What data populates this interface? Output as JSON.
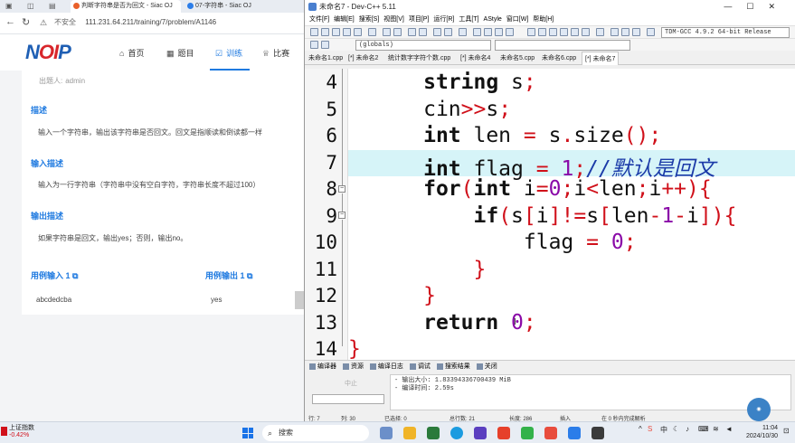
{
  "browser": {
    "tabs": [
      {
        "label": "判断字符串是否为回文 - Siac OJ"
      },
      {
        "label": "07-字符串 - Siac OJ"
      }
    ],
    "address": {
      "security": "不安全",
      "url": "111.231.64.211/training/7/problem/A1146"
    },
    "site": {
      "logo_main": "N",
      "logo_accent": "OI",
      "logo_end": "P",
      "nav": [
        {
          "label": "首页",
          "icon": "home-icon"
        },
        {
          "label": "题目",
          "icon": "grid-icon"
        },
        {
          "label": "训练",
          "icon": "check-icon"
        },
        {
          "label": "比赛",
          "icon": "trophy-icon"
        }
      ]
    },
    "problem": {
      "author_label": "出题人:",
      "author": "admin",
      "desc_title": "描述",
      "desc": "输入一个字符串，输出该字符串是否回文。回文是指顺读和倒读都一样",
      "input_title": "输入描述",
      "input_desc": "输入为一行字符串（字符串中没有空白字符，字符串长度不超过100）",
      "output_title": "输出描述",
      "output_desc": "如果字符串是回文，输出yes；否则，输出no。",
      "sample_input_title": "用例输入 1",
      "sample_output_title": "用例输出 1",
      "sample_input": "abcdedcba",
      "sample_output": "yes"
    }
  },
  "devcpp": {
    "title": "未命名7 - Dev-C++ 5.11",
    "menus": [
      "文件[F]",
      "编辑[E]",
      "搜索[S]",
      "视图[V]",
      "项目[P]",
      "运行[R]",
      "工具[T]",
      "AStyle",
      "窗口[W]",
      "帮助[H]"
    ],
    "globals_combo": "(globals)",
    "compiler_combo": "TDM-GCC 4.9.2 64-bit Release",
    "file_tabs": [
      "未命名1.cpp",
      "[*] 未命名2",
      "统计数字字符个数.cpp",
      "[*] 未命名4",
      "未命名5.cpp",
      "未命名6.cpp",
      "[*] 未命名7"
    ],
    "line_numbers": [
      "4",
      "5",
      "6",
      "7",
      "8",
      "9",
      "10",
      "11",
      "12",
      "13",
      "14"
    ],
    "code": {
      "l4_kw": "string",
      "l4_rest": " s",
      "l4_semi": ";",
      "l5_a": "cin",
      "l5_op": ">>",
      "l5_b": "s",
      "l5_semi": ";",
      "l6_kw": "int",
      "l6_a": " len ",
      "l6_eq": "=",
      "l6_b": " s",
      "l6_dot": ".",
      "l6_c": "size",
      "l6_par": "()",
      "l6_semi": ";",
      "l7_kw": "int",
      "l7_a": " flag ",
      "l7_eq": "=",
      "l7_num": " 1",
      "l7_semi": ";",
      "l7_comment": "//默认是回文",
      "l8_kw": "for",
      "l8_p1": "(",
      "l8_kw2": "int",
      "l8_a": " i",
      "l8_eq": "=",
      "l8_num": "0",
      "l8_s1": ";",
      "l8_b": "i",
      "l8_lt": "<",
      "l8_c": "len",
      "l8_s2": ";",
      "l8_d": "i",
      "l8_inc": "++",
      "l8_p2": "){",
      "l9_kw": "if",
      "l9_p1": "(",
      "l9_a": "s",
      "l9_b1": "[",
      "l9_b": "i",
      "l9_b2": "]",
      "l9_ne": "!=",
      "l9_c": "s",
      "l9_b3": "[",
      "l9_d": "len",
      "l9_minus": "-",
      "l9_one": "1",
      "l9_minus2": "-",
      "l9_e": "i",
      "l9_end": "]){",
      "l10_a": "flag ",
      "l10_eq": "=",
      "l10_num": " 0",
      "l10_semi": ";",
      "l11": "}",
      "l12": "}",
      "l13_kw": "return",
      "l13_num": " 0",
      "l13_semi": ";",
      "l14": "}"
    },
    "bottom_tabs": [
      "编译器",
      "资源",
      "编译日志",
      "调试",
      "搜索结果",
      "关闭"
    ],
    "abort_label": "中止",
    "output_lines": [
      "- 输出大小: 1.83394336700439 MiB",
      "- 编译时间: 2.59s"
    ],
    "status": {
      "row_label": "行:",
      "row": "7",
      "col_label": "列:",
      "col": "30",
      "sel_label": "已选择:",
      "sel": "0",
      "total_label": "总行数:",
      "total": "21",
      "len_label": "长度:",
      "len": "286",
      "mode": "插入",
      "parse": "在 0 秒内完成解析"
    }
  },
  "taskbar": {
    "stock_name": "上证指数",
    "stock_change": "-0.42%",
    "search_placeholder": "搜索",
    "time": "11:04",
    "date": "2024/10/30",
    "ime": "中"
  }
}
